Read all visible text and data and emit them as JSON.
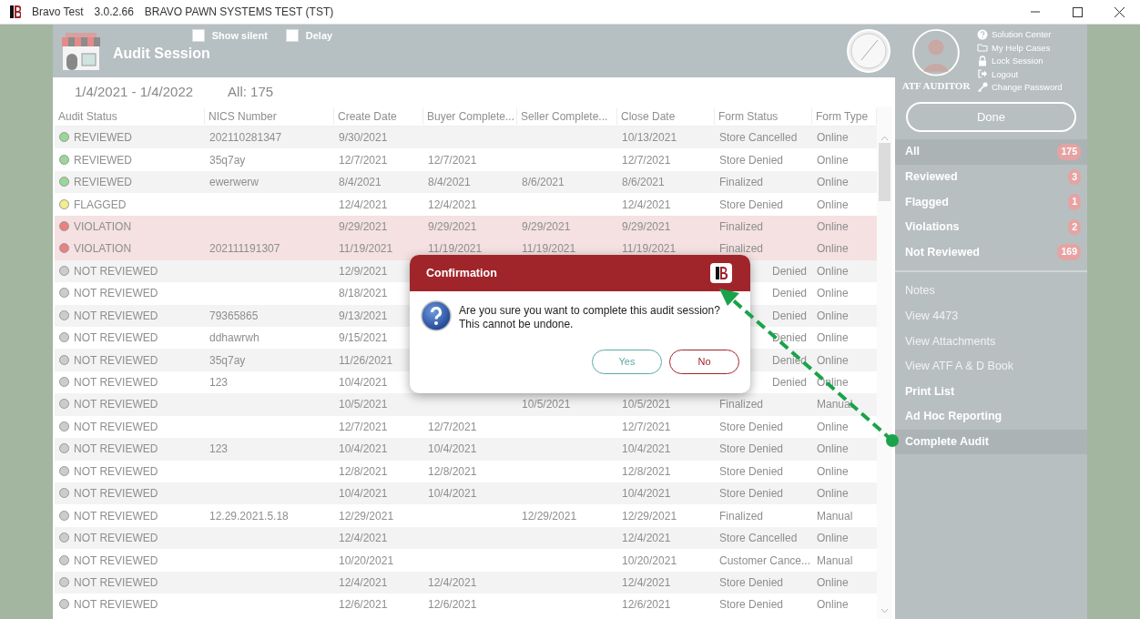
{
  "window": {
    "title": "Bravo Test",
    "version": "3.0.2.66",
    "environment": "BRAVO PAWN SYSTEMS TEST (TST)"
  },
  "header": {
    "title": "Audit Session",
    "options": [
      {
        "label": "Show silent",
        "checked": false
      },
      {
        "label": "Delay",
        "checked": false
      }
    ]
  },
  "user": {
    "name": "ATF AUDITOR",
    "links": [
      {
        "label": "Solution Center",
        "kind": "help"
      },
      {
        "label": "My Help Cases",
        "kind": "folder"
      },
      {
        "label": "Lock Session",
        "kind": "lock"
      },
      {
        "label": "Logout",
        "kind": "logout"
      },
      {
        "label": "Change Password",
        "kind": "key"
      }
    ]
  },
  "done_button": "Done",
  "range": {
    "dates": "1/4/2021 - 1/4/2022",
    "count": "All: 175"
  },
  "filters": [
    {
      "label": "All",
      "count": "175",
      "selected": true
    },
    {
      "label": "Reviewed",
      "count": "3",
      "selected": false
    },
    {
      "label": "Flagged",
      "count": "1",
      "selected": false
    },
    {
      "label": "Violations",
      "count": "2",
      "selected": false
    },
    {
      "label": "Not Reviewed",
      "count": "169",
      "selected": false
    }
  ],
  "actions": [
    {
      "label": "Notes",
      "disabled": true,
      "selected": false
    },
    {
      "label": "View 4473",
      "disabled": true,
      "selected": false
    },
    {
      "label": "View Attachments",
      "disabled": true,
      "selected": false
    },
    {
      "label": "View ATF A & D Book",
      "disabled": true,
      "selected": false
    },
    {
      "label": "Print List",
      "disabled": false,
      "selected": false
    },
    {
      "label": "Ad Hoc Reporting",
      "disabled": false,
      "selected": false
    },
    {
      "label": "Complete Audit",
      "disabled": false,
      "selected": true
    }
  ],
  "table": {
    "columns": [
      "Audit Status",
      "NICS Number",
      "Create Date",
      "Buyer Complete...",
      "Seller Complete...",
      "Close Date",
      "Form Status",
      "Form Type"
    ],
    "rows": [
      {
        "color": "#98d898",
        "highlighted": false,
        "cells": [
          "REVIEWED",
          "202110281347",
          "9/30/2021",
          null,
          null,
          "10/13/2021",
          "Store Cancelled",
          "Online"
        ]
      },
      {
        "color": "#98d898",
        "highlighted": false,
        "cells": [
          "REVIEWED",
          "35q7ay",
          "12/7/2021",
          "12/7/2021",
          null,
          "12/7/2021",
          "Store Denied",
          "Online"
        ]
      },
      {
        "color": "#98d898",
        "highlighted": false,
        "cells": [
          "REVIEWED",
          "ewerwerw",
          "8/4/2021",
          "8/4/2021",
          "8/6/2021",
          "8/6/2021",
          "Finalized",
          "Online"
        ]
      },
      {
        "color": "#f2ee8c",
        "highlighted": false,
        "cells": [
          "FLAGGED",
          null,
          "12/4/2021",
          "12/4/2021",
          null,
          "12/4/2021",
          "Store Denied",
          "Online"
        ]
      },
      {
        "color": "#ea8080",
        "highlighted": true,
        "cells": [
          "VIOLATION",
          null,
          "9/29/2021",
          "9/29/2021",
          "9/29/2021",
          "9/29/2021",
          "Finalized",
          "Online"
        ]
      },
      {
        "color": "#ea8080",
        "highlighted": true,
        "cells": [
          "VIOLATION",
          "202111191307",
          "11/19/2021",
          "11/19/2021",
          "11/19/2021",
          "11/19/2021",
          "Finalized",
          "Online"
        ]
      },
      {
        "color": "#cccccc",
        "highlighted": false,
        "cells": [
          "NOT REVIEWED",
          null,
          "12/9/2021",
          null,
          null,
          null,
          "Denied",
          "Online"
        ]
      },
      {
        "color": "#cccccc",
        "highlighted": false,
        "cells": [
          "NOT REVIEWED",
          null,
          "8/18/2021",
          null,
          null,
          null,
          "Denied",
          "Online"
        ]
      },
      {
        "color": "#cccccc",
        "highlighted": false,
        "cells": [
          "NOT REVIEWED",
          "79365865",
          "9/13/2021",
          null,
          null,
          null,
          "Denied",
          "Online"
        ]
      },
      {
        "color": "#cccccc",
        "highlighted": false,
        "cells": [
          "NOT REVIEWED",
          "ddhawrwh",
          "9/15/2021",
          null,
          null,
          null,
          "Denied",
          "Online"
        ]
      },
      {
        "color": "#cccccc",
        "highlighted": false,
        "cells": [
          "NOT REVIEWED",
          "35q7ay",
          "11/26/2021",
          null,
          null,
          null,
          "Denied",
          "Online"
        ]
      },
      {
        "color": "#cccccc",
        "highlighted": false,
        "cells": [
          "NOT REVIEWED",
          "123",
          "10/4/2021",
          null,
          null,
          null,
          "Denied",
          "Online"
        ]
      },
      {
        "color": "#cccccc",
        "highlighted": false,
        "cells": [
          "NOT REVIEWED",
          null,
          "10/5/2021",
          null,
          "10/5/2021",
          "10/5/2021",
          "Finalized",
          "Manual"
        ]
      },
      {
        "color": "#cccccc",
        "highlighted": false,
        "cells": [
          "NOT REVIEWED",
          null,
          "12/7/2021",
          "12/7/2021",
          null,
          "12/7/2021",
          "Store Denied",
          "Online"
        ]
      },
      {
        "color": "#cccccc",
        "highlighted": false,
        "cells": [
          "NOT REVIEWED",
          "123",
          "10/4/2021",
          "10/4/2021",
          null,
          "10/4/2021",
          "Store Denied",
          "Online"
        ]
      },
      {
        "color": "#cccccc",
        "highlighted": false,
        "cells": [
          "NOT REVIEWED",
          null,
          "12/8/2021",
          "12/8/2021",
          null,
          "12/8/2021",
          "Store Denied",
          "Online"
        ]
      },
      {
        "color": "#cccccc",
        "highlighted": false,
        "cells": [
          "NOT REVIEWED",
          null,
          "10/4/2021",
          "10/4/2021",
          null,
          "10/4/2021",
          "Store Denied",
          "Online"
        ]
      },
      {
        "color": "#cccccc",
        "highlighted": false,
        "cells": [
          "NOT REVIEWED",
          "12.29.2021.5.18",
          "12/29/2021",
          null,
          "12/29/2021",
          "12/29/2021",
          "Finalized",
          "Manual"
        ]
      },
      {
        "color": "#cccccc",
        "highlighted": false,
        "cells": [
          "NOT REVIEWED",
          null,
          "12/4/2021",
          null,
          null,
          "12/4/2021",
          "Store Cancelled",
          "Online"
        ]
      },
      {
        "color": "#cccccc",
        "highlighted": false,
        "cells": [
          "NOT REVIEWED",
          null,
          "10/20/2021",
          null,
          null,
          "10/20/2021",
          "Customer Cance...",
          "Manual"
        ]
      },
      {
        "color": "#cccccc",
        "highlighted": false,
        "cells": [
          "NOT REVIEWED",
          null,
          "12/4/2021",
          "12/4/2021",
          null,
          "12/4/2021",
          "Store Denied",
          "Online"
        ]
      },
      {
        "color": "#cccccc",
        "highlighted": false,
        "cells": [
          "NOT REVIEWED",
          null,
          "12/6/2021",
          "12/6/2021",
          null,
          "12/6/2021",
          "Store Denied",
          "Online"
        ]
      }
    ]
  },
  "dialog": {
    "title": "Confirmation",
    "message": [
      "Are you sure you want to complete this audit session?",
      "This cannot be undone."
    ],
    "buttons": [
      {
        "label": "Yes",
        "kind": "confirm"
      },
      {
        "label": "No",
        "kind": "cancel"
      }
    ]
  }
}
